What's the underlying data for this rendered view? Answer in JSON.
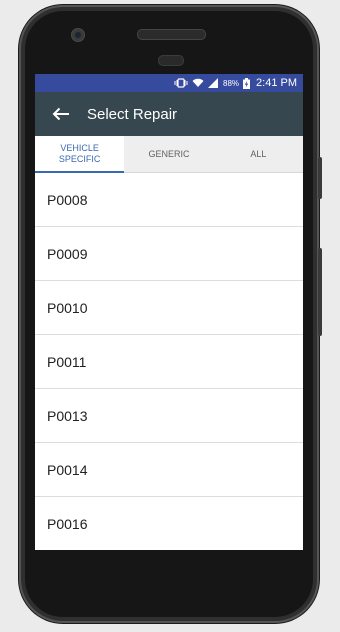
{
  "status_bar": {
    "battery_percent": "88%",
    "time": "2:41 PM",
    "icons": [
      "vibrate-icon",
      "wifi-icon",
      "signal-icon",
      "battery-charging-icon"
    ]
  },
  "app_bar": {
    "title": "Select Repair",
    "back_icon": "arrow-back-icon"
  },
  "tabs": [
    {
      "label": "VEHICLE SPECIFIC",
      "active": true
    },
    {
      "label": "GENERIC",
      "active": false
    },
    {
      "label": "ALL",
      "active": false
    }
  ],
  "repairs": [
    "P0008",
    "P0009",
    "P0010",
    "P0011",
    "P0013",
    "P0014",
    "P0016"
  ],
  "colors": {
    "status_bar": "#364a9e",
    "app_bar": "#37474f",
    "tab_active": "#3b69b0"
  }
}
